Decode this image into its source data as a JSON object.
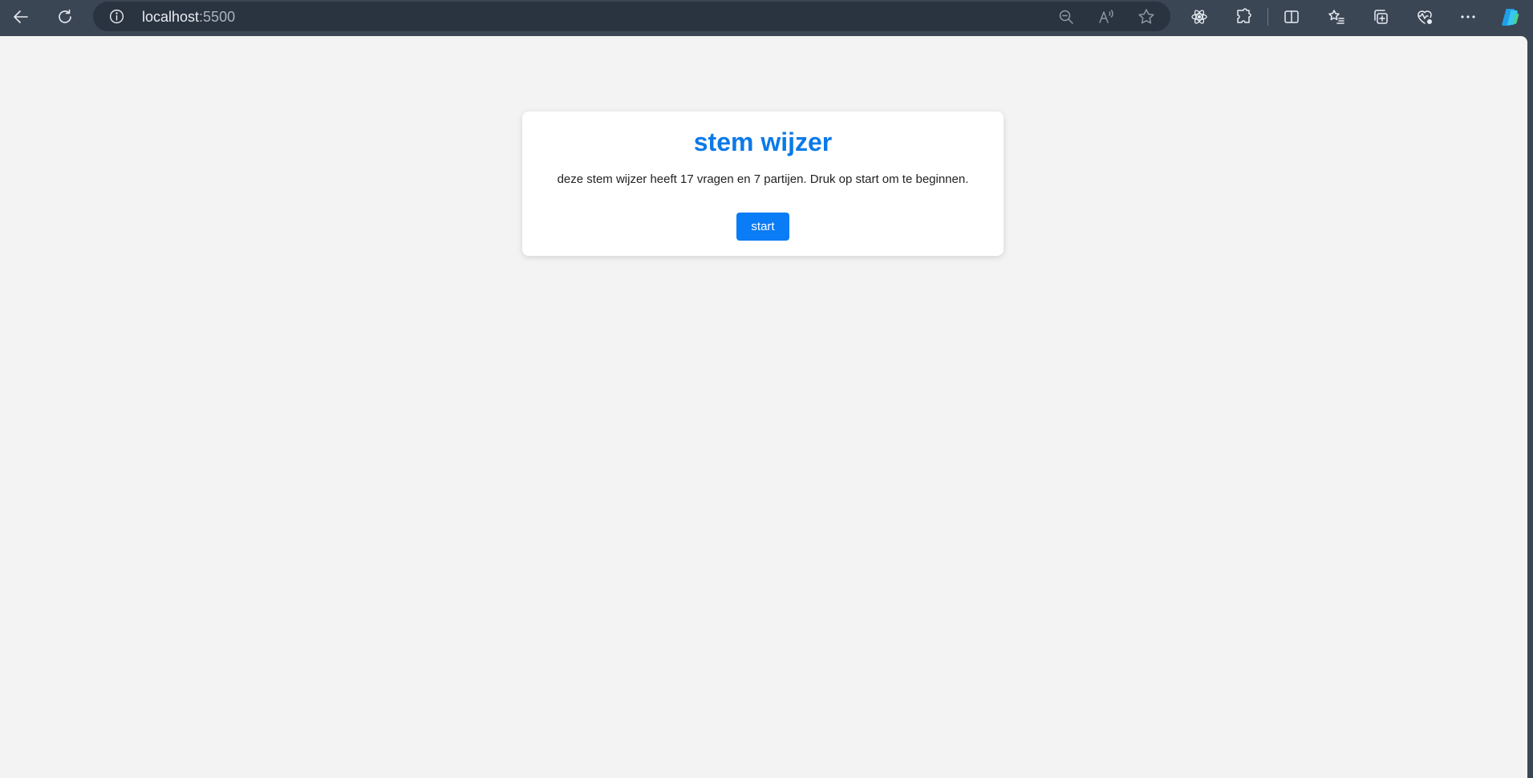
{
  "browser": {
    "address_bar": {
      "host": "localhost",
      "port": ":5500"
    },
    "icons": {
      "back": "back-arrow-icon",
      "refresh": "refresh-icon",
      "site_info": "info-icon",
      "zoom_out": "zoom-out-icon",
      "read_aloud": "read-aloud-icon",
      "favorite": "star-icon",
      "react_devtools": "atom-icon",
      "extensions": "puzzle-icon",
      "split_screen": "split-screen-icon",
      "favorites": "favorites-list-icon",
      "collections": "collections-icon",
      "browser_essentials": "heart-pulse-icon",
      "more": "more-icon",
      "copilot": "copilot-icon"
    },
    "colors": {
      "toolbar": "#3b4655",
      "address_bar": "#2a3340",
      "page_background": "#f3f3f3"
    }
  },
  "page": {
    "card": {
      "title": "stem wijzer",
      "description": "deze stem wijzer heeft 17 vragen en 7 partijen. Druk op start om te beginnen.",
      "start_label": "start"
    },
    "colors": {
      "title": "#0a7ae8",
      "button": "#0a7cf6"
    }
  }
}
